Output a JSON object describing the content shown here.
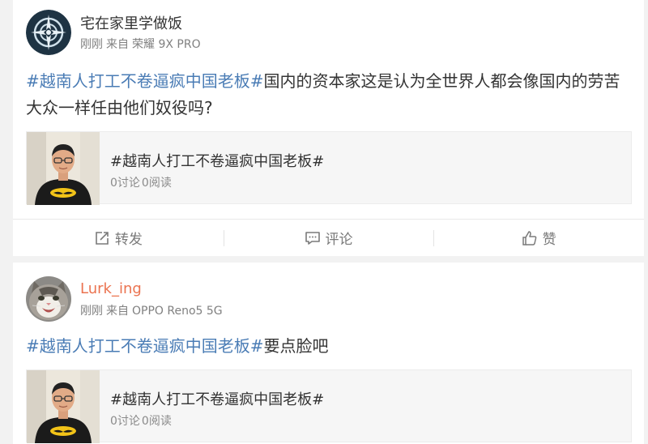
{
  "posts": [
    {
      "username": "宅在家里学做饭",
      "time": "刚刚",
      "source_label": "来自",
      "device": "荣耀 9X PRO",
      "hashtag": "#越南人打工不卷逼疯中国老板#",
      "body": "国内的资本家这是认为全世界人都会像国内的劳苦大众一样任由他们奴役吗?",
      "share": {
        "title": "#越南人打工不卷逼疯中国老板#",
        "discussions": "0讨论",
        "reads": "0阅读"
      },
      "actions": {
        "repost_label": "转发",
        "comment_label": "评论",
        "like_label": "赞"
      }
    },
    {
      "username": "Lurk_ing",
      "time": "刚刚",
      "source_label": "来自",
      "device": "OPPO Reno5 5G",
      "hashtag": "#越南人打工不卷逼疯中国老板#",
      "body": "要点脸吧",
      "share": {
        "title": "#越南人打工不卷逼疯中国老板#",
        "discussions": "0讨论",
        "reads": "0阅读"
      }
    }
  ],
  "icons": {
    "avatar1": "compass-logo-avatar",
    "avatar2": "cat-avatar",
    "thumbnail": "man-batman-shirt-photo",
    "repost": "repost-icon",
    "comment": "comment-icon",
    "like": "thumbs-up-icon"
  },
  "colors": {
    "hashtag": "#4a7cb5",
    "username_highlight": "#eb7350",
    "meta": "#808080"
  }
}
